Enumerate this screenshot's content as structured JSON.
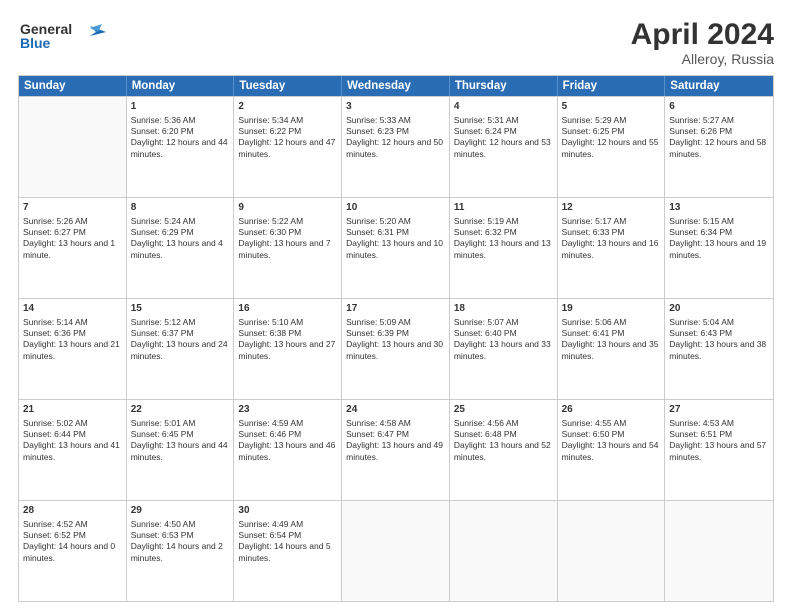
{
  "header": {
    "logo_line1": "General",
    "logo_line2": "Blue",
    "month_year": "April 2024",
    "location": "Alleroy, Russia"
  },
  "days_of_week": [
    "Sunday",
    "Monday",
    "Tuesday",
    "Wednesday",
    "Thursday",
    "Friday",
    "Saturday"
  ],
  "weeks": [
    [
      {
        "day": "",
        "sunrise": "",
        "sunset": "",
        "daylight": "",
        "empty": true
      },
      {
        "day": "1",
        "sunrise": "Sunrise: 5:36 AM",
        "sunset": "Sunset: 6:20 PM",
        "daylight": "Daylight: 12 hours and 44 minutes."
      },
      {
        "day": "2",
        "sunrise": "Sunrise: 5:34 AM",
        "sunset": "Sunset: 6:22 PM",
        "daylight": "Daylight: 12 hours and 47 minutes."
      },
      {
        "day": "3",
        "sunrise": "Sunrise: 5:33 AM",
        "sunset": "Sunset: 6:23 PM",
        "daylight": "Daylight: 12 hours and 50 minutes."
      },
      {
        "day": "4",
        "sunrise": "Sunrise: 5:31 AM",
        "sunset": "Sunset: 6:24 PM",
        "daylight": "Daylight: 12 hours and 53 minutes."
      },
      {
        "day": "5",
        "sunrise": "Sunrise: 5:29 AM",
        "sunset": "Sunset: 6:25 PM",
        "daylight": "Daylight: 12 hours and 55 minutes."
      },
      {
        "day": "6",
        "sunrise": "Sunrise: 5:27 AM",
        "sunset": "Sunset: 6:26 PM",
        "daylight": "Daylight: 12 hours and 58 minutes."
      }
    ],
    [
      {
        "day": "7",
        "sunrise": "Sunrise: 5:26 AM",
        "sunset": "Sunset: 6:27 PM",
        "daylight": "Daylight: 13 hours and 1 minute."
      },
      {
        "day": "8",
        "sunrise": "Sunrise: 5:24 AM",
        "sunset": "Sunset: 6:29 PM",
        "daylight": "Daylight: 13 hours and 4 minutes."
      },
      {
        "day": "9",
        "sunrise": "Sunrise: 5:22 AM",
        "sunset": "Sunset: 6:30 PM",
        "daylight": "Daylight: 13 hours and 7 minutes."
      },
      {
        "day": "10",
        "sunrise": "Sunrise: 5:20 AM",
        "sunset": "Sunset: 6:31 PM",
        "daylight": "Daylight: 13 hours and 10 minutes."
      },
      {
        "day": "11",
        "sunrise": "Sunrise: 5:19 AM",
        "sunset": "Sunset: 6:32 PM",
        "daylight": "Daylight: 13 hours and 13 minutes."
      },
      {
        "day": "12",
        "sunrise": "Sunrise: 5:17 AM",
        "sunset": "Sunset: 6:33 PM",
        "daylight": "Daylight: 13 hours and 16 minutes."
      },
      {
        "day": "13",
        "sunrise": "Sunrise: 5:15 AM",
        "sunset": "Sunset: 6:34 PM",
        "daylight": "Daylight: 13 hours and 19 minutes."
      }
    ],
    [
      {
        "day": "14",
        "sunrise": "Sunrise: 5:14 AM",
        "sunset": "Sunset: 6:36 PM",
        "daylight": "Daylight: 13 hours and 21 minutes."
      },
      {
        "day": "15",
        "sunrise": "Sunrise: 5:12 AM",
        "sunset": "Sunset: 6:37 PM",
        "daylight": "Daylight: 13 hours and 24 minutes."
      },
      {
        "day": "16",
        "sunrise": "Sunrise: 5:10 AM",
        "sunset": "Sunset: 6:38 PM",
        "daylight": "Daylight: 13 hours and 27 minutes."
      },
      {
        "day": "17",
        "sunrise": "Sunrise: 5:09 AM",
        "sunset": "Sunset: 6:39 PM",
        "daylight": "Daylight: 13 hours and 30 minutes."
      },
      {
        "day": "18",
        "sunrise": "Sunrise: 5:07 AM",
        "sunset": "Sunset: 6:40 PM",
        "daylight": "Daylight: 13 hours and 33 minutes."
      },
      {
        "day": "19",
        "sunrise": "Sunrise: 5:06 AM",
        "sunset": "Sunset: 6:41 PM",
        "daylight": "Daylight: 13 hours and 35 minutes."
      },
      {
        "day": "20",
        "sunrise": "Sunrise: 5:04 AM",
        "sunset": "Sunset: 6:43 PM",
        "daylight": "Daylight: 13 hours and 38 minutes."
      }
    ],
    [
      {
        "day": "21",
        "sunrise": "Sunrise: 5:02 AM",
        "sunset": "Sunset: 6:44 PM",
        "daylight": "Daylight: 13 hours and 41 minutes."
      },
      {
        "day": "22",
        "sunrise": "Sunrise: 5:01 AM",
        "sunset": "Sunset: 6:45 PM",
        "daylight": "Daylight: 13 hours and 44 minutes."
      },
      {
        "day": "23",
        "sunrise": "Sunrise: 4:59 AM",
        "sunset": "Sunset: 6:46 PM",
        "daylight": "Daylight: 13 hours and 46 minutes."
      },
      {
        "day": "24",
        "sunrise": "Sunrise: 4:58 AM",
        "sunset": "Sunset: 6:47 PM",
        "daylight": "Daylight: 13 hours and 49 minutes."
      },
      {
        "day": "25",
        "sunrise": "Sunrise: 4:56 AM",
        "sunset": "Sunset: 6:48 PM",
        "daylight": "Daylight: 13 hours and 52 minutes."
      },
      {
        "day": "26",
        "sunrise": "Sunrise: 4:55 AM",
        "sunset": "Sunset: 6:50 PM",
        "daylight": "Daylight: 13 hours and 54 minutes."
      },
      {
        "day": "27",
        "sunrise": "Sunrise: 4:53 AM",
        "sunset": "Sunset: 6:51 PM",
        "daylight": "Daylight: 13 hours and 57 minutes."
      }
    ],
    [
      {
        "day": "28",
        "sunrise": "Sunrise: 4:52 AM",
        "sunset": "Sunset: 6:52 PM",
        "daylight": "Daylight: 14 hours and 0 minutes."
      },
      {
        "day": "29",
        "sunrise": "Sunrise: 4:50 AM",
        "sunset": "Sunset: 6:53 PM",
        "daylight": "Daylight: 14 hours and 2 minutes."
      },
      {
        "day": "30",
        "sunrise": "Sunrise: 4:49 AM",
        "sunset": "Sunset: 6:54 PM",
        "daylight": "Daylight: 14 hours and 5 minutes."
      },
      {
        "day": "",
        "sunrise": "",
        "sunset": "",
        "daylight": "",
        "empty": true
      },
      {
        "day": "",
        "sunrise": "",
        "sunset": "",
        "daylight": "",
        "empty": true
      },
      {
        "day": "",
        "sunrise": "",
        "sunset": "",
        "daylight": "",
        "empty": true
      },
      {
        "day": "",
        "sunrise": "",
        "sunset": "",
        "daylight": "",
        "empty": true
      }
    ]
  ]
}
